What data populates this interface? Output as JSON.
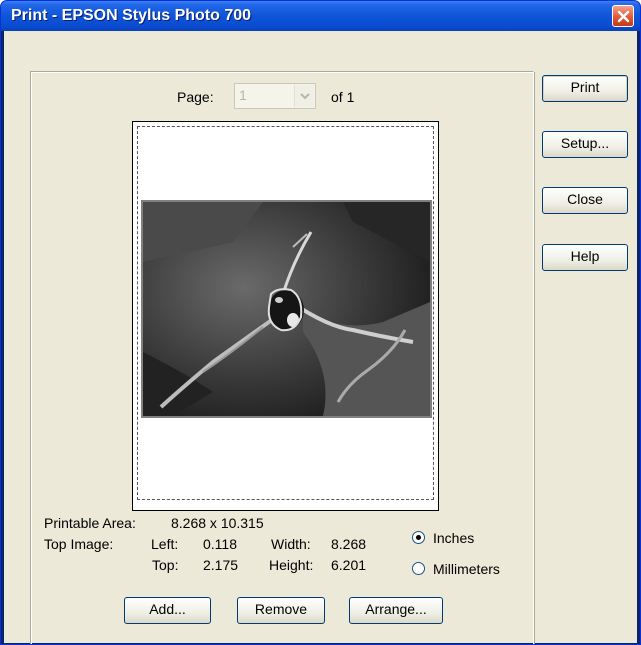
{
  "window": {
    "title": "Print - EPSON Stylus Photo 700"
  },
  "page_selector": {
    "page_label": "Page:",
    "page_value": "1",
    "of_text": "of 1"
  },
  "side_buttons": {
    "print": "Print",
    "setup": "Setup...",
    "close": "Close",
    "help": "Help"
  },
  "info": {
    "printable_area_label": "Printable Area:",
    "printable_area_value": "8.268 x 10.315",
    "top_image_label": "Top Image:",
    "left_label": "Left:",
    "left_value": "0.118",
    "top_label": "Top:",
    "top_value": "2.175",
    "width_label": "Width:",
    "width_value": "8.268",
    "height_label": "Height:",
    "height_value": "6.201"
  },
  "units": {
    "inches_label": "Inches",
    "millimeters_label": "Millimeters",
    "selected": "Inches"
  },
  "bottom_buttons": {
    "add": "Add...",
    "remove": "Remove",
    "arrange": "Arrange..."
  },
  "colors": {
    "titlebar": "#0a4bd1",
    "dialog_bg": "#ece9d8",
    "close_button": "#e15a35"
  },
  "icons": {
    "close": "close-x-icon",
    "combo_arrow": "chevron-down-icon"
  }
}
